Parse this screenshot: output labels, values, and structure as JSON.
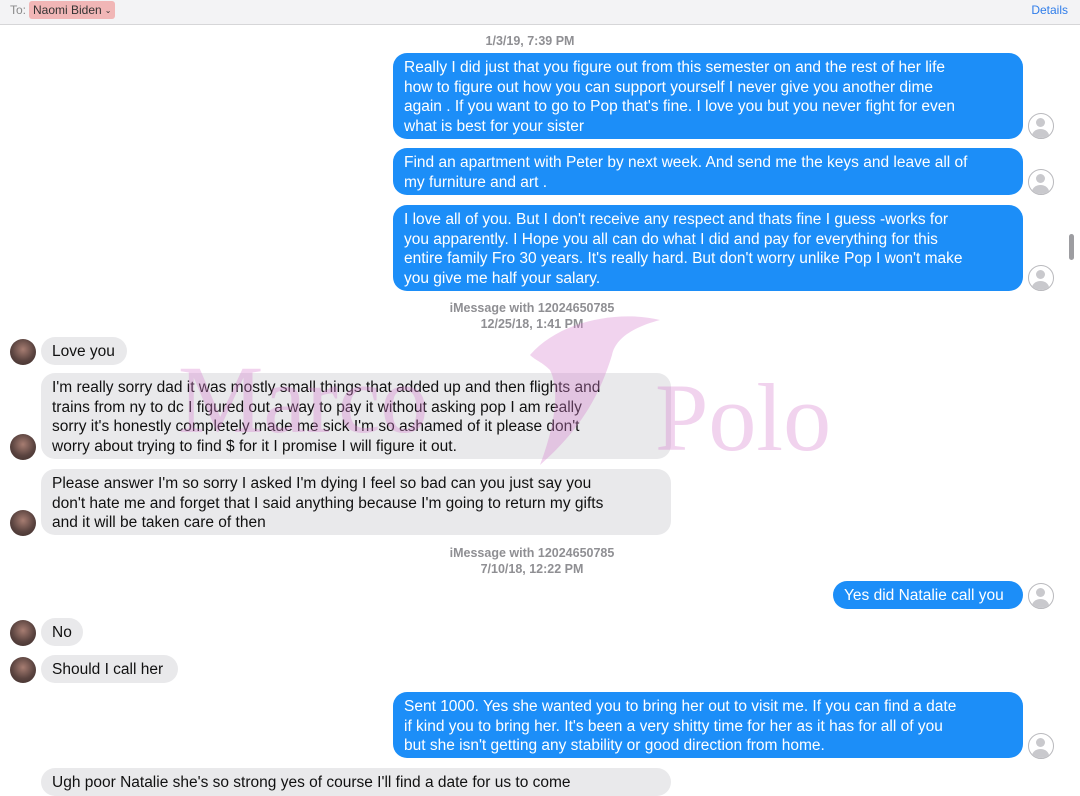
{
  "header": {
    "to_label": "To:",
    "recipient": "Naomi Biden",
    "chip_caret": "⌄",
    "details_label": "Details"
  },
  "timestamps": [
    {
      "line1": "1/3/19, 7:39 PM",
      "line2": ""
    },
    {
      "line1": "iMessage with 12024650785",
      "line2": "12/25/18, 1:41 PM"
    },
    {
      "line1": "iMessage with 12024650785",
      "line2": "7/10/18, 12:22 PM"
    }
  ],
  "messages": [
    {
      "direction": "sent",
      "text": "Really I did just that you figure out from this semester on and the rest of her life\nhow to figure out how you can support yourself I never give you another dime\nagain . If you want to  go to Pop that's fine. I love you but you never fight for even\nwhat is best for your sister"
    },
    {
      "direction": "sent",
      "text": "Find an apartment with Peter by next week. And send me the keys and leave all of\nmy furniture and art ."
    },
    {
      "direction": "sent",
      "text": "I love all of you. But I don't receive any respect and thats fine I guess -works for\nyou apparently. I Hope you all can do what I did and pay for everything for this\nentire family Fro 30 years. It's really hard. But don't worry unlike Pop I won't make\nyou give me half your salary."
    },
    {
      "direction": "received",
      "text": "Love you"
    },
    {
      "direction": "received",
      "text": "I'm really sorry dad it was mostly small things that added up and then flights and\ntrains from ny to dc I figured out a way to pay it without asking pop I am really\nsorry it's honestly completely made me sick I'm so ashamed of it please don't\nworry about trying to find $ for it I promise I will figure it out."
    },
    {
      "direction": "received",
      "text": "Please answer I'm so sorry I asked I'm dying I feel so bad can you just say you\ndon't hate me and forget that I said anything because I'm going to return my gifts\nand it will be taken care of then"
    },
    {
      "direction": "sent",
      "text": "Yes did Natalie call you"
    },
    {
      "direction": "received",
      "text": "No"
    },
    {
      "direction": "received",
      "text": "Should I call her"
    },
    {
      "direction": "sent",
      "text": "Sent 1000. Yes she wanted you to bring her out to visit me. If you can find a date\nif kind you to bring her. It's been a very shitty time for her as it has for all of you\nbut she isn't getting any stability or good direction from home."
    },
    {
      "direction": "received",
      "text": "Ugh poor Natalie she's so strong yes of course I'll find a date for us to come"
    }
  ],
  "watermark": {
    "word1": "Marco",
    "word2": "Polo"
  },
  "colors": {
    "sent_bubble": "#1c8ef8",
    "received_bubble": "#e9e9eb",
    "header_link": "#2f7dea",
    "recipient_chip": "#f1b6b6"
  },
  "icons": {
    "self_avatar": "person-silhouette-icon",
    "contact_avatar": "contact-photo",
    "logo": "dolphin-icon"
  }
}
